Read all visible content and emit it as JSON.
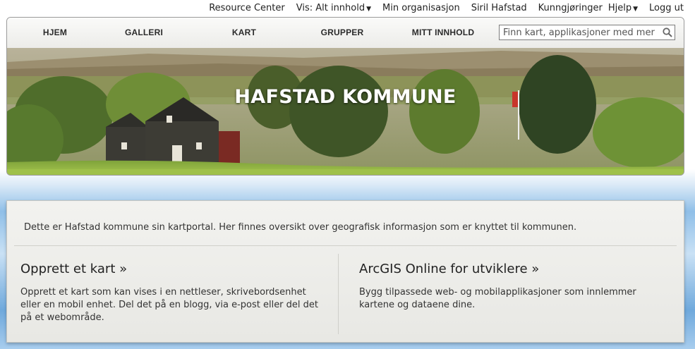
{
  "topbar": {
    "resource_center": "Resource Center",
    "view_label": "Vis: Alt innhold",
    "my_org": "Min organisasjon",
    "user": "Siril Hafstad",
    "announcements": "Kunngjøringer",
    "help": "Hjelp",
    "logout": "Logg ut"
  },
  "nav": {
    "items": [
      "HJEM",
      "GALLERI",
      "KART",
      "GRUPPER",
      "MITT INNHOLD"
    ]
  },
  "search": {
    "placeholder": "Finn kart, applikasjoner med mer ..."
  },
  "banner": {
    "title": "HAFSTAD KOMMUNE"
  },
  "main": {
    "intro": "Dette er Hafstad kommune sin kartportal. Her finnes oversikt over geografisk informasjon som er knyttet til kommunen.",
    "cards": [
      {
        "title": "Opprett et kart »",
        "text": "Opprett et kart som kan vises i en nettleser, skrivebordsenhet eller en mobil enhet. Del det på en blogg, via e-post eller del det på et webområde."
      },
      {
        "title": "ArcGIS Online for utviklere »",
        "text": "Bygg tilpassede web- og mobilapplikasjoner som innlemmer kartene og dataene dine."
      }
    ]
  },
  "icons": {
    "search": "search-icon",
    "dropdown": "caret-down-icon"
  }
}
